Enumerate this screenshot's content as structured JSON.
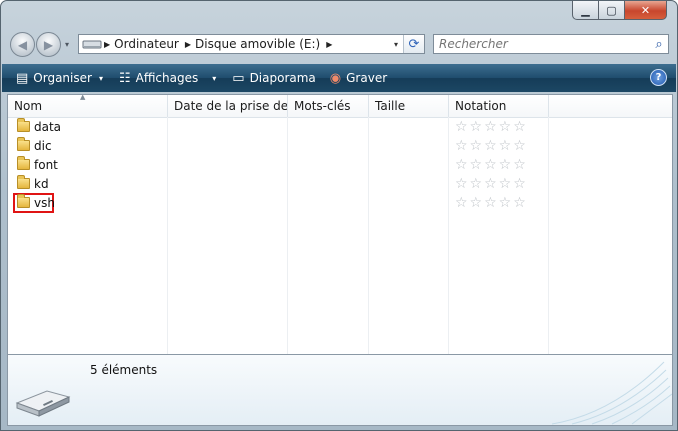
{
  "window": {
    "controls": {
      "minimize": "▁",
      "maximize": "▢",
      "close": "✕"
    }
  },
  "nav": {
    "back_icon": "◀",
    "forward_icon": "▶",
    "history_icon": "▾"
  },
  "address": {
    "segments": [
      "Ordinateur",
      "Disque amovible (E:)"
    ],
    "separator": "▶",
    "dropdown": "▾",
    "refresh": "⟳"
  },
  "search": {
    "placeholder": "Rechercher",
    "icon": "⌕"
  },
  "toolbar": {
    "items": [
      {
        "label": "Organiser",
        "icon": "▤",
        "dropdown": "▾"
      },
      {
        "label": "Affichages",
        "icon": "☷",
        "dropdown": "▾"
      },
      {
        "label": "Diaporama",
        "icon": "▭"
      },
      {
        "label": "Graver",
        "icon": "◉"
      }
    ],
    "help": "?"
  },
  "columns": [
    "Nom",
    "Date de la prise de ...",
    "Mots-clés",
    "Taille",
    "Notation"
  ],
  "sort_indicator": "▲",
  "files": [
    {
      "name": "data",
      "rating_stars": "☆☆☆☆☆"
    },
    {
      "name": "dic",
      "rating_stars": "☆☆☆☆☆"
    },
    {
      "name": "font",
      "rating_stars": "☆☆☆☆☆"
    },
    {
      "name": "kd",
      "rating_stars": "☆☆☆☆☆"
    },
    {
      "name": "vsh",
      "rating_stars": "☆☆☆☆☆"
    }
  ],
  "status": {
    "count": "5 éléments"
  },
  "colors": {
    "toolbar": "#1f4c6d",
    "highlight": "#e01414",
    "frame": "#aebfcc"
  }
}
